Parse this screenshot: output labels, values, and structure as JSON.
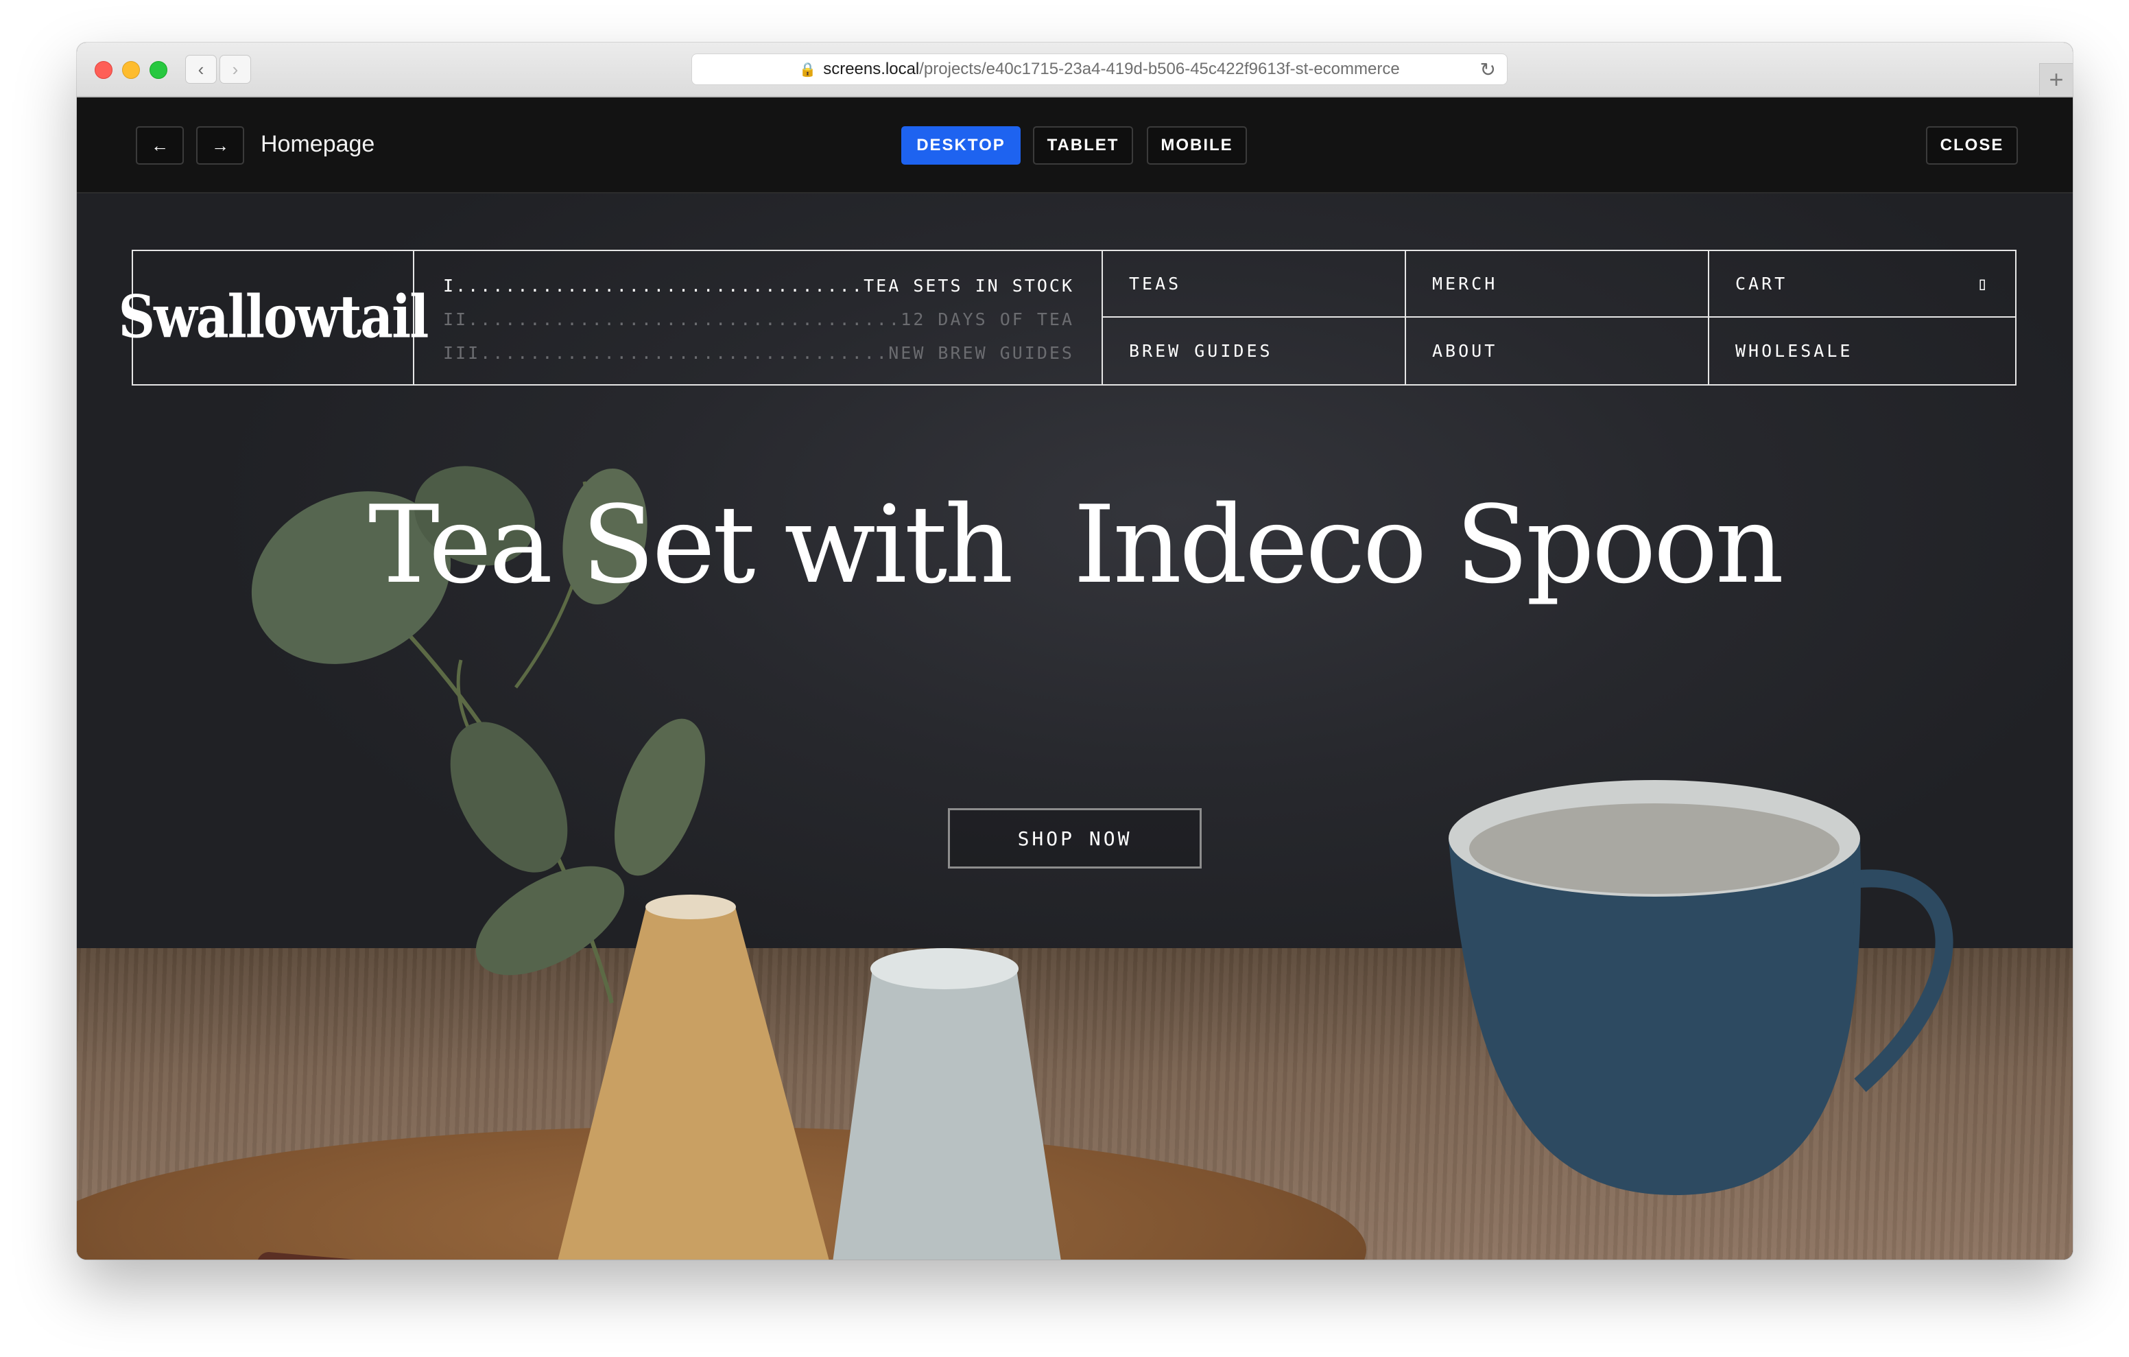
{
  "browser": {
    "url_host": "screens.local",
    "url_path": "/projects/e40c1715-23a4-419d-b506-45c422f9613f-st-ecommerce",
    "back_glyph": "‹",
    "forward_glyph": "›",
    "reload_glyph": "↻",
    "new_tab_glyph": "+"
  },
  "toolbar": {
    "prev_glyph": "←",
    "next_glyph": "→",
    "page_title": "Homepage",
    "devices": [
      "DESKTOP",
      "TABLET",
      "MOBILE"
    ],
    "active_device": "DESKTOP",
    "close_label": "CLOSE",
    "accent_color": "#1e63f0"
  },
  "site": {
    "logo": "Swallowtail",
    "news": [
      {
        "num": "I",
        "text": "TEA SETS IN STOCK"
      },
      {
        "num": "II",
        "text": "12 DAYS OF TEA"
      },
      {
        "num": "III",
        "text": "NEW BREW GUIDES"
      }
    ],
    "menu": {
      "teas": "TEAS",
      "brew_guides": "BREW GUIDES",
      "merch": "MERCH",
      "about": "ABOUT",
      "cart": "CART",
      "wholesale": "WHOLESALE"
    },
    "hero_title": "Tea Set with  Indeco Spoon",
    "cta_label": "SHOP NOW"
  }
}
